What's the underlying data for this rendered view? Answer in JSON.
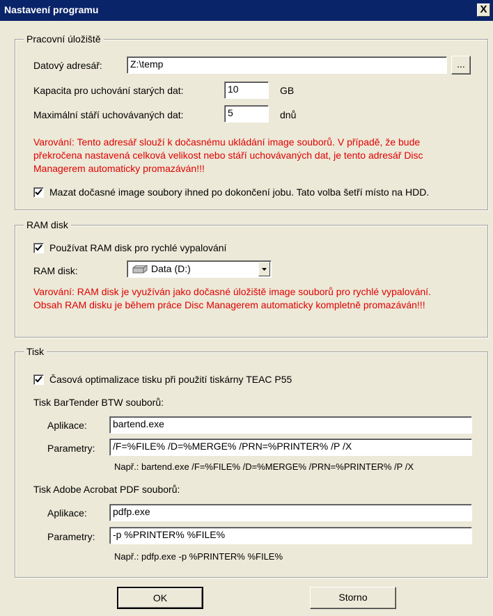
{
  "window": {
    "title": "Nastavení programu",
    "close_symbol": "X"
  },
  "storage": {
    "legend": "Pracovní úložiště",
    "data_dir_label": "Datový adresář:",
    "data_dir_value": "Z:\\temp",
    "browse_label": "...",
    "capacity_label": "Kapacita pro uchování starých dat:",
    "capacity_value": "10",
    "capacity_unit": "GB",
    "max_age_label": "Maximální stáří uchovávaných dat:",
    "max_age_value": "5",
    "max_age_unit": "dnů",
    "warning_lines": [
      "Varování: Tento adresář slouží k dočasnému ukládání image souborů. V případě, že bude",
      "překročena nastavená celková velikost nebo stáří uchovávaných dat, je tento adresář Disc",
      "Managerem automaticky promazáván!!!"
    ],
    "delete_checkbox_label": "Mazat dočasné image soubory ihned po dokončení jobu. Tato volba šetří místo na HDD.",
    "delete_checked": true
  },
  "ramdisk": {
    "legend": "RAM disk",
    "use_checkbox_label": "Používat RAM disk pro rychlé vypalování",
    "use_checked": true,
    "select_label": "RAM disk:",
    "select_value": "Data (D:)",
    "warning_lines": [
      "Varování: RAM disk je využíván jako dočasné úložiště image souborů pro rychlé vypalování.",
      "Obsah RAM disku je během práce Disc Managerem automaticky kompletně promazáván!!!"
    ]
  },
  "print": {
    "legend": "Tisk",
    "optimize_checkbox_label": "Časová optimalizace tisku při použití tiskárny TEAC P55",
    "optimize_checked": true,
    "bartender": {
      "heading": "Tisk BarTender BTW souborů:",
      "app_label": "Aplikace:",
      "app_value": "bartend.exe",
      "params_label": "Parametry:",
      "params_value": "/F=%FILE% /D=%MERGE% /PRN=%PRINTER% /P /X",
      "example": "Např.: bartend.exe /F=%FILE% /D=%MERGE% /PRN=%PRINTER% /P /X"
    },
    "acrobat": {
      "heading": "Tisk Adobe Acrobat PDF souborů:",
      "app_label": "Aplikace:",
      "app_value": "pdfp.exe",
      "params_label": "Parametry:",
      "params_value": "-p %PRINTER% %FILE%",
      "example": "Např.: pdfp.exe -p %PRINTER% %FILE%"
    }
  },
  "buttons": {
    "ok": "OK",
    "cancel": "Storno"
  },
  "colors": {
    "titlebar": "#0A246A",
    "dialog_bg": "#ECE9D8",
    "warning": "#E00000"
  },
  "icons": {
    "drive": "hard-drive-icon",
    "dropdown": "chevron-down-icon",
    "check": "checkmark-icon"
  }
}
